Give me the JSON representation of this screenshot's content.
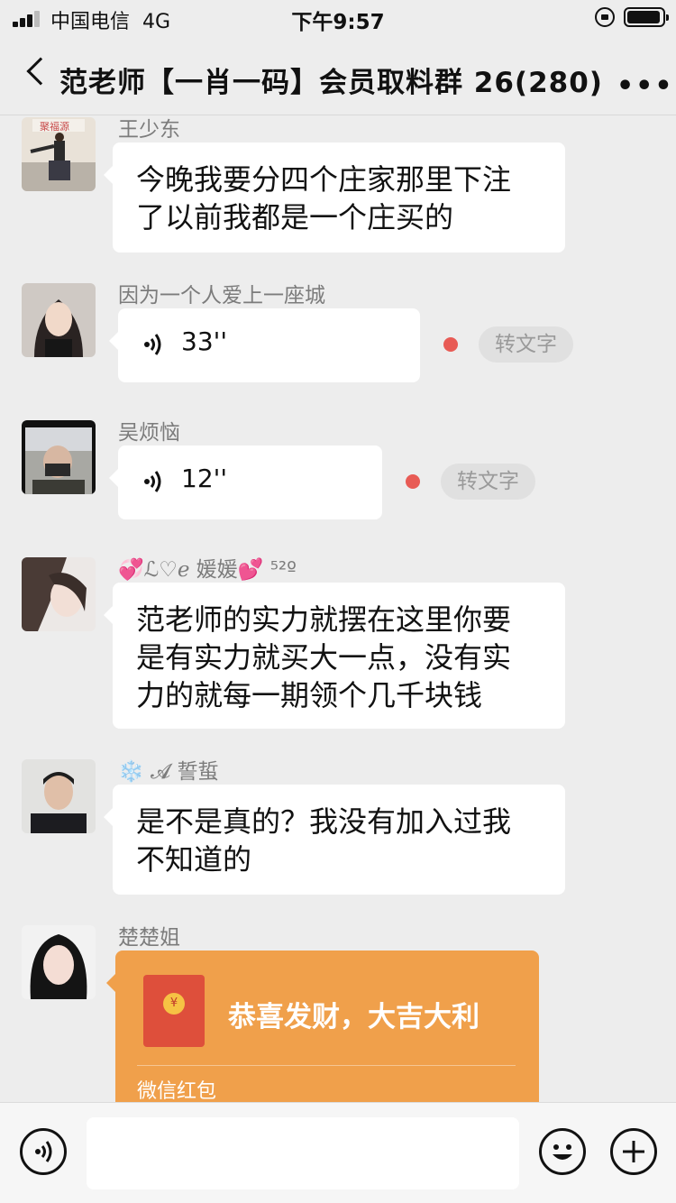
{
  "status_bar": {
    "carrier": "中国电信",
    "network": "4G",
    "time": "下午9:57"
  },
  "nav": {
    "title": "范老师【一肖一码】会员取料群 26(280)",
    "more": "•••"
  },
  "messages": [
    {
      "sender": "王少东",
      "type": "text",
      "text_lines": [
        "今晚我要分四个庄家那里下注",
        "了以前我都是一个庄买的"
      ]
    },
    {
      "sender": "因为一个人爱上一座城",
      "type": "voice",
      "duration": "33''",
      "unread": true,
      "to_text": "转文字"
    },
    {
      "sender": "吴烦恼",
      "type": "voice",
      "duration": "12''",
      "unread": true,
      "to_text": "转文字"
    },
    {
      "sender": "💞ℒ♡ℯ 媛媛💕 ⁵²º",
      "type": "text",
      "text_lines": [
        "范老师的实力就摆在这里你要",
        "是有实力就买大一点，没有实",
        "力的就每一期领个几千块钱"
      ]
    },
    {
      "sender": "❄️ 𝓐 誓蜇",
      "type": "text",
      "text_lines": [
        "是不是真的？我没有加入过我",
        "不知道的"
      ]
    },
    {
      "sender": "楚楚姐",
      "type": "red_packet",
      "title": "恭喜发财，大吉大利",
      "label": "微信红包",
      "coin": "¥"
    }
  ],
  "input_bar": {
    "placeholder": ""
  },
  "colors": {
    "background": "#ededed",
    "red_packet": "#f0a04b",
    "unread_dot": "#e85b55"
  }
}
